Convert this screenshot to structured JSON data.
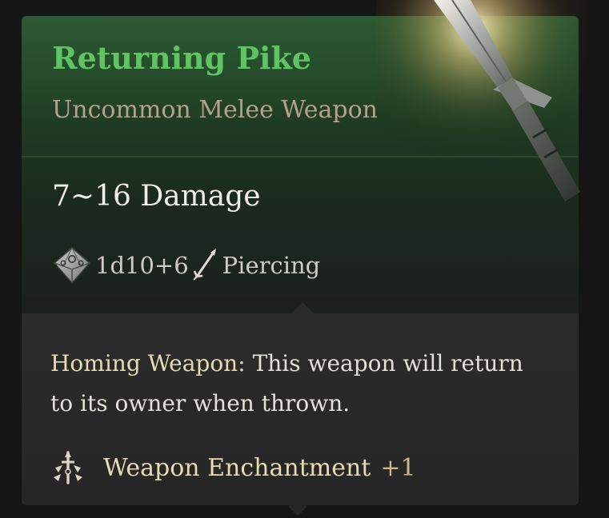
{
  "item": {
    "name": "Returning Pike",
    "subtitle": "Uncommon Melee Weapon",
    "damage": "7~16 Damage",
    "dice": "1d10+6",
    "damage_type": "Piercing",
    "rarity_color": "#5fc563"
  },
  "passive": {
    "name": "Homing Weapon:",
    "description": "This weapon will return to its owner when thrown."
  },
  "enchantment": {
    "label": "Weapon Enchantment",
    "bonus": "+1"
  },
  "icons": {
    "dice": "d10-dice-icon",
    "damage_type": "piercing-arrow-icon",
    "enchantment": "weapon-enchantment-icon",
    "item_image": "pike-spear-icon"
  }
}
